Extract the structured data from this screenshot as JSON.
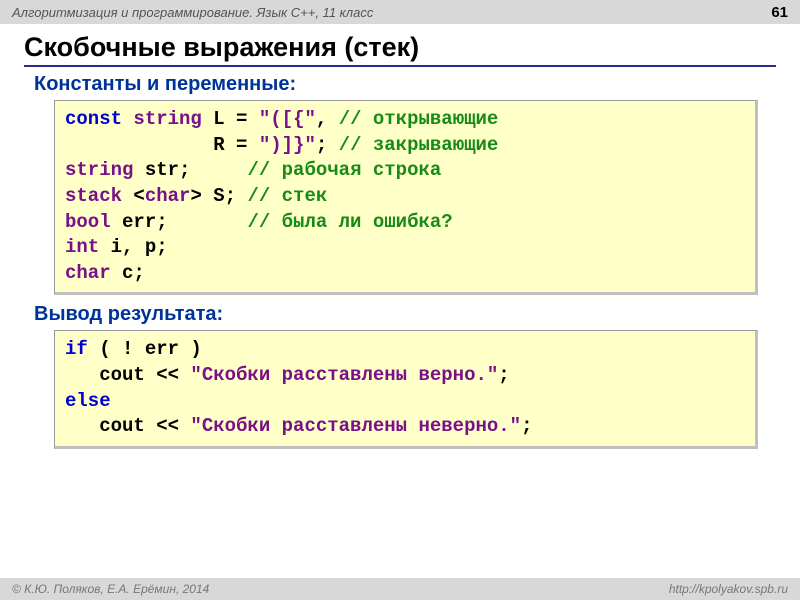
{
  "header": {
    "course": "Алгоритмизация и программирование. Язык C++, 11 класс",
    "page_number": "61"
  },
  "title": "Скобочные выражения (стек)",
  "section1": {
    "label": "Константы и переменные:"
  },
  "code1": {
    "l1_kw": "const",
    "l1_type": "string",
    "l1_var": " L = ",
    "l1_str": "\"([{\"",
    "l1_punc": ", ",
    "l1_com": "// открывающие",
    "l2_pad": "             R = ",
    "l2_str": "\")]}\"",
    "l2_punc": "; ",
    "l2_com": "// закрывающие",
    "l3_type": "string",
    "l3_rest": " str;     ",
    "l3_com": "// рабочая строка",
    "l4_type": "stack",
    "l4_open": " <",
    "l4_inner": "char",
    "l4_close": "> S; ",
    "l4_com": "// стек",
    "l5_type": "bool",
    "l5_rest": " err;       ",
    "l5_com": "// была ли ошибка?",
    "l6_type": "int",
    "l6_rest": " i, p;",
    "l7_type": "char",
    "l7_rest": " c;"
  },
  "section2": {
    "label": "Вывод результата:"
  },
  "code2": {
    "l1_kw": "if",
    "l1_rest": " ( ! err )",
    "l2_pre": "   cout << ",
    "l2_str": "\"Скобки расставлены верно.\"",
    "l2_post": ";",
    "l3_kw": "else",
    "l4_pre": "   cout << ",
    "l4_str": "\"Скобки расставлены неверно.\"",
    "l4_post": ";"
  },
  "footer": {
    "authors": "© К.Ю. Поляков, Е.А. Ерёмин, 2014",
    "url": "http://kpolyakov.spb.ru"
  }
}
